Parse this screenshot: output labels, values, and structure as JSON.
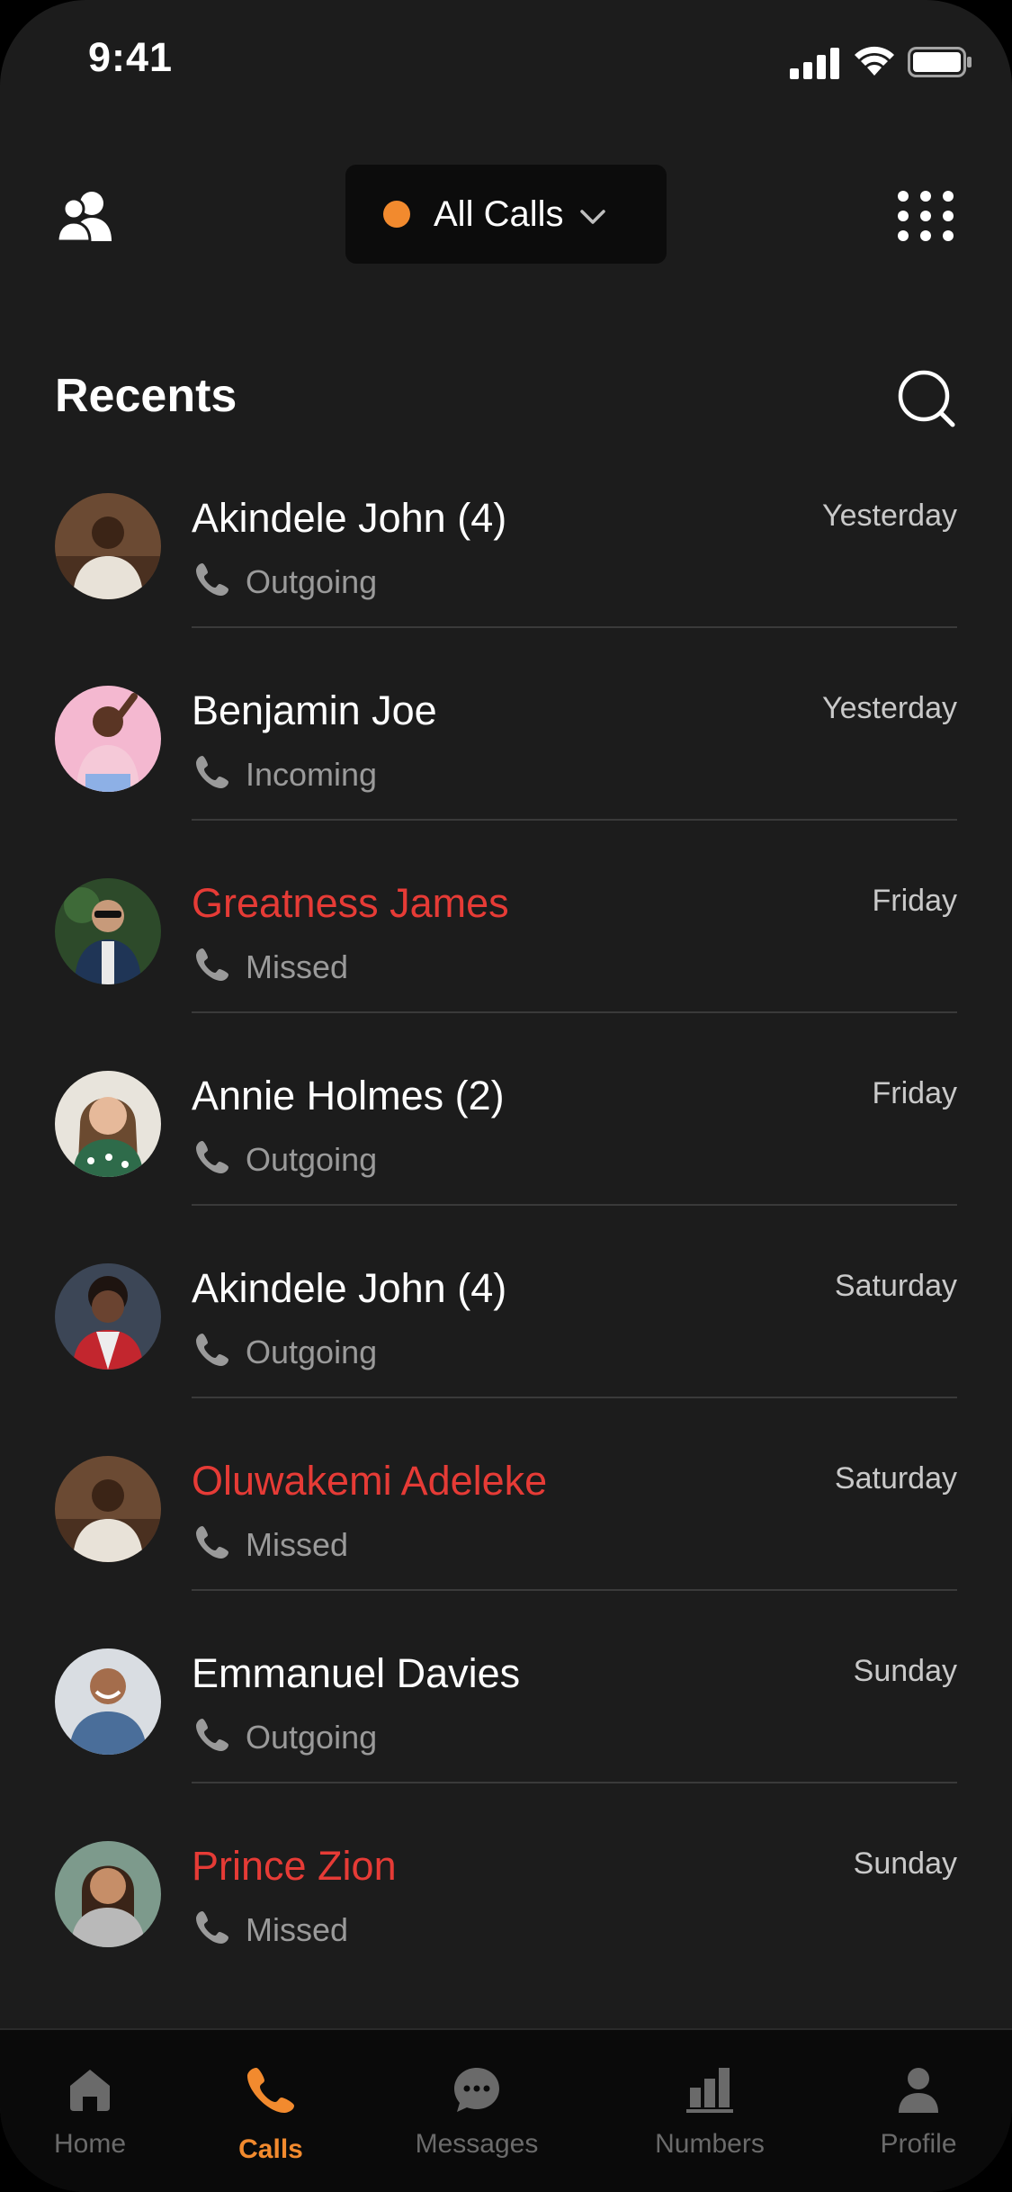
{
  "status_bar": {
    "time": "9:41"
  },
  "header": {
    "filter_label": "All Calls",
    "accent_color": "#f28a2e"
  },
  "recents": {
    "title": "Recents",
    "calls": [
      {
        "name": "Akindele John (4)",
        "type": "Outgoing",
        "time": "Yesterday",
        "missed": false
      },
      {
        "name": "Benjamin Joe",
        "type": "Incoming",
        "time": "Yesterday",
        "missed": false
      },
      {
        "name": "Greatness James",
        "type": "Missed",
        "time": "Friday",
        "missed": true
      },
      {
        "name": "Annie Holmes (2)",
        "type": "Outgoing",
        "time": "Friday",
        "missed": false
      },
      {
        "name": "Akindele John (4)",
        "type": "Outgoing",
        "time": "Saturday",
        "missed": false
      },
      {
        "name": "Oluwakemi Adeleke",
        "type": "Missed",
        "time": "Saturday",
        "missed": true
      },
      {
        "name": "Emmanuel Davies",
        "type": "Outgoing",
        "time": "Sunday",
        "missed": false
      },
      {
        "name": "Prince Zion",
        "type": "Missed",
        "time": "Sunday",
        "missed": true
      }
    ]
  },
  "tab_bar": {
    "tabs": [
      {
        "label": "Home",
        "icon": "home-icon",
        "active": false
      },
      {
        "label": "Calls",
        "icon": "phone-icon",
        "active": true
      },
      {
        "label": "Messages",
        "icon": "chat-bubble-icon",
        "active": false
      },
      {
        "label": "Numbers",
        "icon": "bar-chart-icon",
        "active": false
      },
      {
        "label": "Profile",
        "icon": "person-icon",
        "active": false
      }
    ]
  },
  "colors": {
    "background": "#1c1c1c",
    "missed": "#e63b36",
    "accent": "#f28a2e",
    "inactive_tab": "#6a6a6a"
  }
}
